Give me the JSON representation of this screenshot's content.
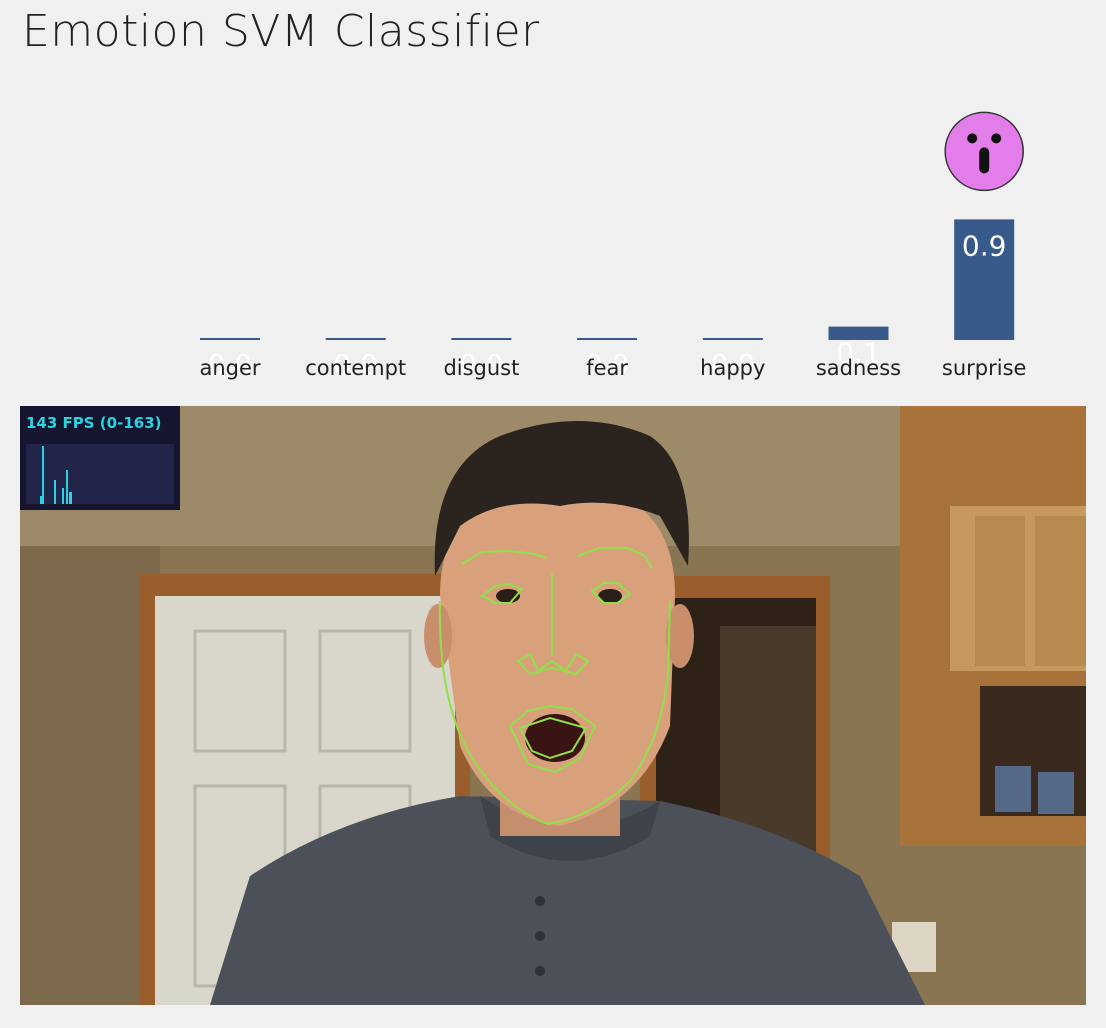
{
  "page": {
    "title": "Emotion SVM Classifier"
  },
  "chart_data": {
    "type": "bar",
    "categories": [
      "anger",
      "contempt",
      "disgust",
      "fear",
      "happy",
      "sadness",
      "surprise"
    ],
    "values": [
      0.0,
      0.0,
      0.0,
      0.0,
      0.0,
      0.1,
      0.9
    ],
    "ylim": [
      0,
      1
    ],
    "bar_color": "#385a8a",
    "top_emotion": "surprise",
    "top_emotion_icon": "surprised-face-icon",
    "icon_color": "#e27de9"
  },
  "stats": {
    "fps_label": "143 FPS (0-163)",
    "fps_color": "#27d4e0",
    "panel_color": "#151530"
  },
  "video": {
    "landmark_color": "#8fe04a"
  }
}
